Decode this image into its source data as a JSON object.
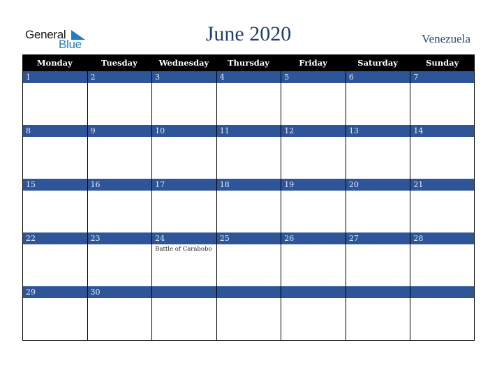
{
  "logo": {
    "line1": "General",
    "line2": "Blue"
  },
  "title": "June 2020",
  "country": "Venezuela",
  "colors": {
    "date_bar": "#2e5597",
    "header_bg": "#000000",
    "title": "#233e6a",
    "logo_blue": "#1f7fc4"
  },
  "weekdays": [
    "Monday",
    "Tuesday",
    "Wednesday",
    "Thursday",
    "Friday",
    "Saturday",
    "Sunday"
  ],
  "weeks": [
    {
      "days": [
        "1",
        "2",
        "3",
        "4",
        "5",
        "6",
        "7"
      ],
      "events": [
        "",
        "",
        "",
        "",
        "",
        "",
        ""
      ]
    },
    {
      "days": [
        "8",
        "9",
        "10",
        "11",
        "12",
        "13",
        "14"
      ],
      "events": [
        "",
        "",
        "",
        "",
        "",
        "",
        ""
      ]
    },
    {
      "days": [
        "15",
        "16",
        "17",
        "18",
        "19",
        "20",
        "21"
      ],
      "events": [
        "",
        "",
        "",
        "",
        "",
        "",
        ""
      ]
    },
    {
      "days": [
        "22",
        "23",
        "24",
        "25",
        "26",
        "27",
        "28"
      ],
      "events": [
        "",
        "",
        "Battle of Carabobo",
        "",
        "",
        "",
        ""
      ]
    },
    {
      "days": [
        "29",
        "30",
        "",
        "",
        "",
        "",
        ""
      ],
      "events": [
        "",
        "",
        "",
        "",
        "",
        "",
        ""
      ]
    }
  ]
}
